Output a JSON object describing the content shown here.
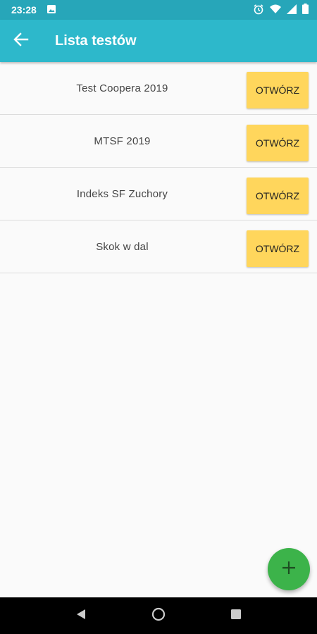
{
  "status_bar": {
    "time": "23:28",
    "icons": [
      "image-icon",
      "alarm-icon",
      "wifi-icon",
      "signal-icon",
      "battery-icon"
    ]
  },
  "app_bar": {
    "title": "Lista testów",
    "back_icon": "arrow-back-icon",
    "color": "#2db8cb"
  },
  "tests": [
    {
      "name": "Test Coopera 2019",
      "action": "OTWÓRZ"
    },
    {
      "name": "MTSF 2019",
      "action": "OTWÓRZ"
    },
    {
      "name": "Indeks SF Zuchory",
      "action": "OTWÓRZ"
    },
    {
      "name": "Skok w dal",
      "action": "OTWÓRZ"
    }
  ],
  "fab": {
    "icon": "plus-icon",
    "color": "#3cb34a"
  },
  "nav_bar": {
    "icons": [
      "back-triangle-icon",
      "home-circle-icon",
      "recents-square-icon"
    ]
  },
  "colors": {
    "button": "#ffd65c",
    "background": "#fafafa"
  }
}
